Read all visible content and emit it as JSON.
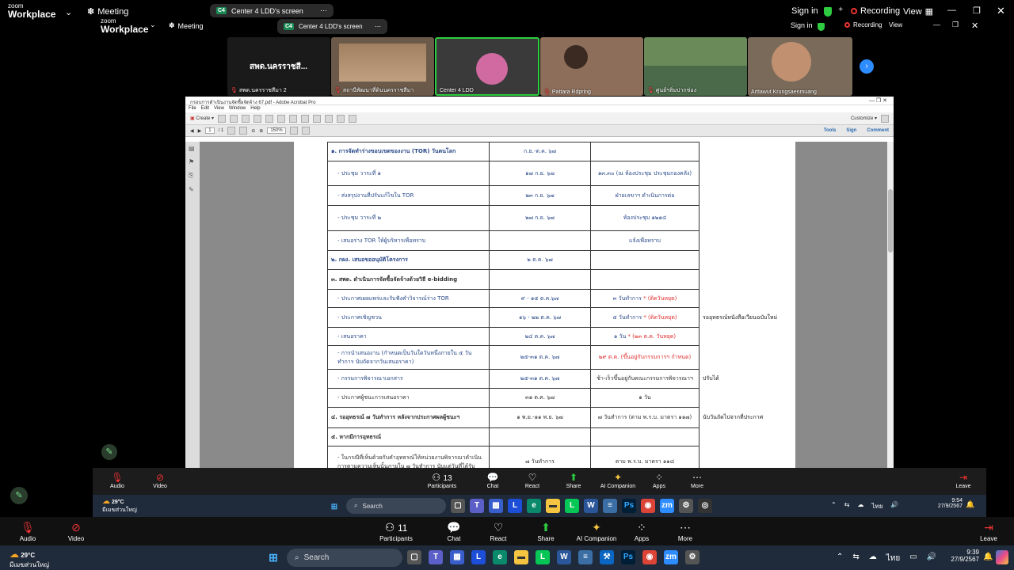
{
  "outer_top": {
    "logo_top": "zoom",
    "logo_bottom": "Workplace",
    "meeting_label": "Meeting",
    "share_tab_label": "Center 4 LDD's screen",
    "share_tab_badge": "C4",
    "sign_in": "Sign in",
    "recording": "Recording",
    "view": "View"
  },
  "inner_top": {
    "logo_top": "zoom",
    "logo_bottom": "Workplace",
    "meeting_label": "Meeting",
    "share_tab_label": "Center 4 LDD's screen",
    "share_tab_badge": "C4",
    "sign_in": "Sign in",
    "recording": "Recording",
    "view": "View"
  },
  "thumbnails": [
    {
      "name": "สพด.นครราชสีมา 2",
      "big_text": "สพด.นครราชสี...",
      "bg": "#1a1a1a"
    },
    {
      "name": "สถานีพัฒนาที่ดินนครราชสีมา",
      "bg": "#6b5a4a"
    },
    {
      "name": "Center 4 LDD",
      "bg": "#3a3a3a"
    },
    {
      "name": "Pattara Rdpring",
      "bg": "#8d6e5a"
    },
    {
      "name": "ศูนย์ฯลิ่มปากช่อง",
      "bg": "#4a6a4a"
    },
    {
      "name": "Arttawut Krungsaenmuang",
      "bg": "#7a6a5a"
    }
  ],
  "acrobat": {
    "title": "กรอบการดำเนินงานจัดซื้อจัดจ้าง 67.pdf - Adobe Acrobat Pro",
    "menu": [
      "File",
      "Edit",
      "View",
      "Window",
      "Help"
    ],
    "create_label": "Create",
    "customize_label": "Customize",
    "page_current": "1",
    "page_total": "/ 1",
    "zoom": "150%",
    "tools": "Tools",
    "sign": "Sign",
    "comment": "Comment"
  },
  "doc_rows": [
    {
      "c1": "๑. การจัดทำร่างขอบเขตของงาน (TOR) วันตนโลก",
      "c2": "ก.ย.-ต.ค. ๖๗",
      "c3": "",
      "c4": "",
      "bold": true
    },
    {
      "c1": "- ประชุม วาระที่ ๑",
      "c2": "๑๗ ก.ย. ๖๗",
      "c3": "๑๓.๓๐ (ณ ห้องประชุม ประชุมกองคลัง)",
      "c4": ""
    },
    {
      "c1": "- ส่งสรุปงานที่ปรับแก้ไขใน TOR",
      "c2": "๒๓ ก.ย. ๖๗",
      "c3": "ฝ่ายเลขาฯ ดำเนินการต่อ",
      "c4": ""
    },
    {
      "c1": "- ประชุม วาระที่ ๒",
      "c2": "๒๗ ก.ย. ๖๗",
      "c3": "ห้องประชุม ๑๒๑๔",
      "c4": ""
    },
    {
      "c1": "- เสนอร่าง TOR ให้ผู้บริหารเพื่อทราบ",
      "c2": "",
      "c3": "แจ้งเพื่อทราบ",
      "c4": ""
    },
    {
      "c1": "๒. กผง. เสนอขออนุมัติโครงการ",
      "c2": "๒ ต.ค. ๖๗",
      "c3": "",
      "c4": "",
      "bold": true
    },
    {
      "c1": "๓. สพด. ดำเนินการจัดซื้อจัดจ้างด้วยวิธี e-bidding",
      "c2": "",
      "c3": "",
      "c4": "",
      "bold": true,
      "black": true
    },
    {
      "c1": "- ประกาศเผยแพร่และรับฟังคำวิจารณ์ร่าง TOR",
      "c2": "๙ - ๑๕ ต.ค.๖๗",
      "c3": "๓ วันทำการ",
      "c3r": " * (ติดวันหยุด)",
      "c4": ""
    },
    {
      "c1": "- ประกาศเชิญชวน",
      "c2": "๑๖ - ๒๒ ต.ค. ๖๗",
      "c3": "๕ วันทำการ",
      "c3r": " * (ติดวันหยุด)",
      "c4": "รออุทธรณ์หนังสือเวียนฉบับใหม่",
      "c4red": true
    },
    {
      "c1": "- เสนอราคา",
      "c2": "๒๔ ต.ค. ๖๗",
      "c3": "๑ วัน",
      "c3r": " * (๒๓ ต.ค. วันหยุด)",
      "c4": ""
    },
    {
      "c1": "- การนำเสนองาน (กำหนดเป็นวันใดวันหนึ่งภายใน ๕ วันทำการ นับถัดจากวันเสนอราคา)",
      "c2": "๒๕-๓๑ ต.ค. ๖๗",
      "c3": "",
      "c3r": "๒๙ ต.ค. (ขึ้นอยู่กับกรรมการฯ กำหนด)",
      "c4": ""
    },
    {
      "c1": "- กรรมการพิจารณาเอกสาร",
      "c2": "๒๕-๓๑ ต.ค. ๖๗",
      "c3": "ช้า-เร็วขึ้นอยู่กับคณะกรรมการพิจารณาฯ",
      "c4": "ปรับได้",
      "c3black": true
    },
    {
      "c1": "- ประกาศผู้ชนะการเสนอราคา",
      "c2": "๓๑ ต.ค. ๖๗",
      "c3": "๑ วัน",
      "c4": "",
      "black": true
    },
    {
      "c1": "๔. รออุทธรณ์ ๗ วันทำการ หลังจากประกาศผลผู้ชนะฯ",
      "c2": "๑ พ.ย.-๑๑ พ.ย. ๖๗",
      "c3": "๗ วันทำการ (ตาม พ.ร.บ. มาตรา ๑๑๗)",
      "c4": "นับวันถัดไปจากที่ประกาศ",
      "bold": true,
      "black": true
    },
    {
      "c1": "๕. หากมีการอุทธรณ์",
      "c2": "",
      "c3": "",
      "c4": "",
      "bold": true,
      "black": true
    },
    {
      "c1": "- ในกรณีที่เห็นด้วยกับคำอุทธรณ์ให้หน่วยงานพิจารณาดำเนินการตามความเห็นนั้นภายใน ๗ วันทำการ นับแต่วันที่ได้รับ",
      "c2": "๗ วันทำการ",
      "c3": "ตาม พ.ร.บ. มาตรา ๑๑๘",
      "c4": "",
      "black": true
    }
  ],
  "inner_bottom": {
    "audio": "Audio",
    "video": "Video",
    "participants": "Participants",
    "participants_count": "13",
    "chat": "Chat",
    "react": "React",
    "share": "Share",
    "ai": "AI Companion",
    "apps": "Apps",
    "more": "More",
    "leave": "Leave"
  },
  "inner_taskbar": {
    "weather_temp": "29°C",
    "weather_desc": "มีเมฆส่วนใหญ่",
    "search": "Search",
    "lang": "ไทย",
    "time": "9:54",
    "date": "27/9/2567"
  },
  "outer_bottom": {
    "audio": "Audio",
    "video": "Video",
    "participants": "Participants",
    "participants_count": "11",
    "chat": "Chat",
    "react": "React",
    "share": "Share",
    "ai": "AI Companion",
    "apps": "Apps",
    "more": "More",
    "leave": "Leave"
  },
  "outer_taskbar": {
    "weather_temp": "29°C",
    "weather_desc": "มีเมฆส่วนใหญ่",
    "search": "Search",
    "lang": "ไทย",
    "time": "9:39",
    "date": "27/9/2567"
  }
}
